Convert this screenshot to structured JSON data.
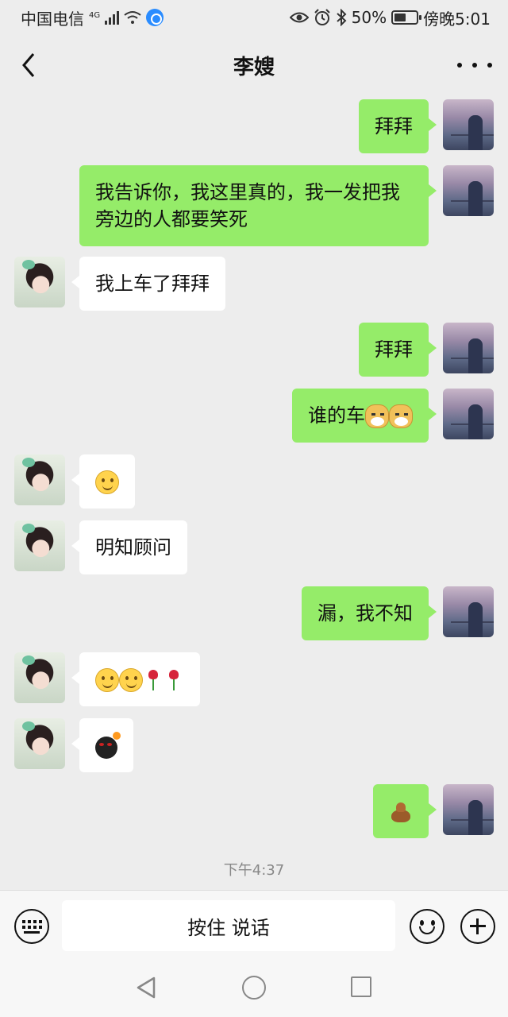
{
  "status_bar": {
    "carrier": "中国电信",
    "network": "4G",
    "battery": "50%",
    "time": "傍晚5:01",
    "icons": [
      "signal-icon",
      "wifi-icon",
      "app-notification-icon",
      "eye-icon",
      "alarm-icon",
      "bluetooth-icon",
      "battery-icon"
    ]
  },
  "header": {
    "title": "李嫂",
    "back_icon": "chevron-left-icon",
    "more_icon": "more-dots-icon"
  },
  "messages": [
    {
      "from": "me",
      "text": "拜拜"
    },
    {
      "from": "me",
      "text": "我告诉你，我这里真的，我一发把我旁边的人都要笑死"
    },
    {
      "from": "other",
      "text": "我上车了拜拜"
    },
    {
      "from": "me",
      "text": "拜拜"
    },
    {
      "from": "me",
      "text": "谁的车",
      "emojis": [
        "doge-emoji",
        "doge-emoji"
      ]
    },
    {
      "from": "other",
      "text": "",
      "emojis": [
        "smile-emoji"
      ]
    },
    {
      "from": "other",
      "text": "明知顾问"
    },
    {
      "from": "me",
      "text": "漏，我不知"
    },
    {
      "from": "other",
      "text": "",
      "emojis": [
        "smile-emoji",
        "smile-emoji",
        "rose-emoji",
        "rose-emoji"
      ]
    },
    {
      "from": "other",
      "text": "",
      "emojis": [
        "bomb-emoji"
      ]
    },
    {
      "from": "me",
      "text": "",
      "emojis": [
        "poop-emoji"
      ]
    }
  ],
  "timestamp": "下午4:37",
  "input_bar": {
    "voice_label": "按住 说话",
    "keyboard_icon": "keyboard-icon",
    "emoji_icon": "emoji-face-icon",
    "plus_icon": "plus-circle-icon"
  },
  "system_nav": {
    "icons": [
      "back-triangle-icon",
      "home-circle-icon",
      "recent-square-icon"
    ]
  },
  "colors": {
    "background": "#ededed",
    "outgoing_bubble": "#95ec69",
    "incoming_bubble": "#ffffff",
    "timestamp": "#888888"
  }
}
